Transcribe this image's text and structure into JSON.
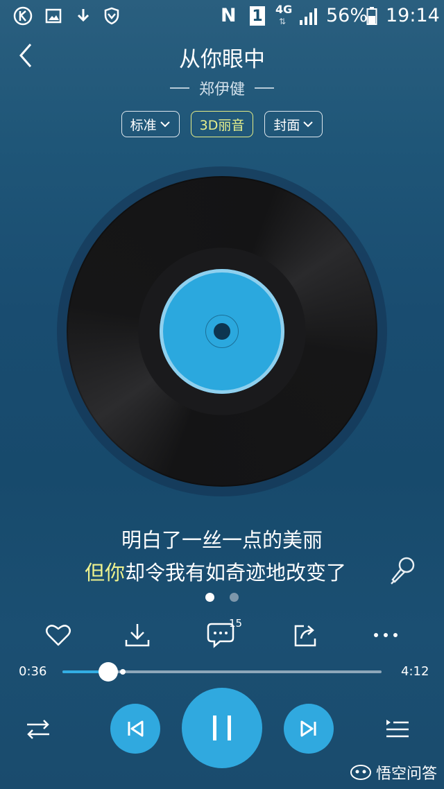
{
  "status_bar": {
    "network_type": "4G",
    "battery_percent": "56%",
    "time": "19:14",
    "sim_label": "1",
    "nfc_label": "N",
    "left_icons": [
      "k-app-icon",
      "gallery-icon",
      "download-icon",
      "shield-icon"
    ]
  },
  "header": {
    "song_title": "从你眼中",
    "artist": "郑伊健"
  },
  "chips": [
    {
      "label": "标准",
      "has_dropdown": true,
      "active": false
    },
    {
      "label": "3D丽音",
      "has_dropdown": false,
      "active": true
    },
    {
      "label": "封面",
      "has_dropdown": true,
      "active": false
    }
  ],
  "lyrics": {
    "line1": "明白了一丝一点的美丽",
    "line2_sung": "但你",
    "line2_rest": "却令我有如奇迹地改变了"
  },
  "pager": {
    "pages": 2,
    "current_index": 0
  },
  "actions": {
    "comment_count": "15",
    "icons": [
      "heart-icon",
      "download-icon",
      "comment-icon",
      "share-icon",
      "more-icon"
    ]
  },
  "progress": {
    "elapsed": "0:36",
    "total": "4:12",
    "played_fraction": 0.143,
    "buffered_fraction": 0.19
  },
  "controls": {
    "icons": [
      "shuffle-icon",
      "previous-icon",
      "pause-icon",
      "next-icon",
      "playlist-icon"
    ]
  },
  "watermark": {
    "text": "悟空问答"
  },
  "colors": {
    "accent": "#30a9df",
    "lyric_highlight": "#eef28e",
    "active_chip": "#e6ee87"
  }
}
